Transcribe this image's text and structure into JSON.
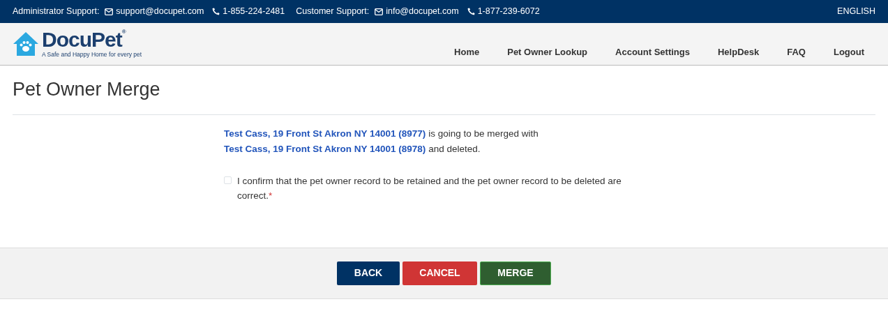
{
  "top_bar": {
    "groups": [
      {
        "label": "Administrator Support:",
        "email": "support@docupet.com",
        "phone": "1-855-224-2481"
      },
      {
        "label": "Customer Support:",
        "email": "info@docupet.com",
        "phone": "1-877-239-6072"
      }
    ],
    "language": "ENGLISH"
  },
  "logo": {
    "name": "DocuPet",
    "mark": "®",
    "tagline": "A Safe and Happy Home for every pet"
  },
  "nav": {
    "items": [
      {
        "label": "Home"
      },
      {
        "label": "Pet Owner Lookup"
      },
      {
        "label": "Account Settings"
      },
      {
        "label": "HelpDesk"
      },
      {
        "label": "FAQ"
      },
      {
        "label": "Logout"
      }
    ]
  },
  "page_title": "Pet Owner Merge",
  "message": [
    {
      "kind": "link",
      "text": "Test Cass, 19 Front St Akron NY 14001 (8977)"
    },
    {
      "kind": "text",
      "text": " is going to be merged with "
    },
    {
      "kind": "link",
      "text": "Test Cass, 19 Front St Akron NY 14001 (8978)"
    },
    {
      "kind": "text",
      "text": " and deleted."
    }
  ],
  "confirm": {
    "label": "I confirm that the pet owner record to be retained and the pet owner record to be deleted are correct.",
    "required_mark": "*",
    "checked": false
  },
  "buttons": [
    {
      "label": "BACK",
      "kind": "back"
    },
    {
      "label": "CANCEL",
      "kind": "cancel"
    },
    {
      "label": "MERGE",
      "kind": "merge"
    }
  ]
}
